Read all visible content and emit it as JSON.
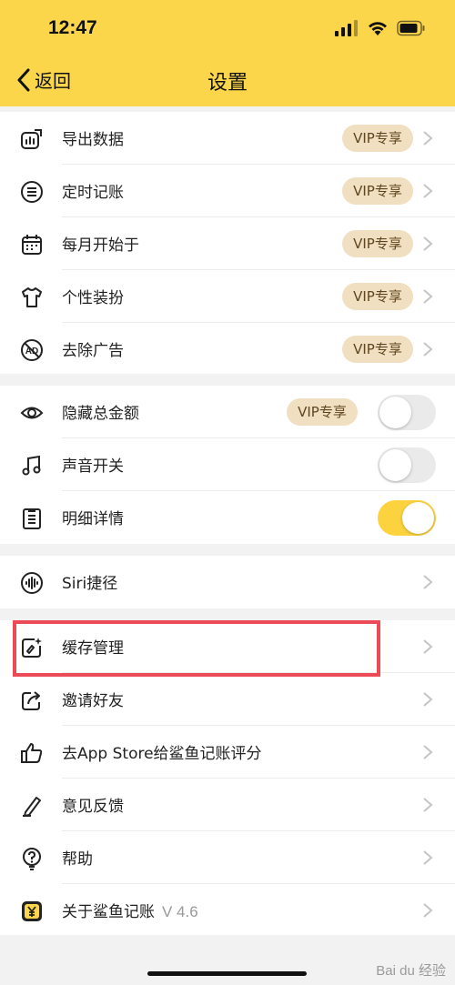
{
  "status": {
    "time": "12:47"
  },
  "nav": {
    "back_label": "返回",
    "title": "设置"
  },
  "group1": [
    {
      "label": "导出数据",
      "badge": "VIP专享"
    },
    {
      "label": "定时记账",
      "badge": "VIP专享"
    },
    {
      "label": "每月开始于",
      "badge": "VIP专享"
    },
    {
      "label": "个性装扮",
      "badge": "VIP专享"
    },
    {
      "label": "去除广告",
      "badge": "VIP专享"
    }
  ],
  "group2": [
    {
      "label": "隐藏总金额",
      "badge": "VIP专享",
      "toggle_on": false
    },
    {
      "label": "声音开关",
      "toggle_on": false
    },
    {
      "label": "明细详情",
      "toggle_on": true
    }
  ],
  "group3": [
    {
      "label": "Siri捷径"
    }
  ],
  "group4": [
    {
      "label": "缓存管理",
      "highlighted": true
    },
    {
      "label": "邀请好友"
    },
    {
      "label": "去App Store给鲨鱼记账评分"
    },
    {
      "label": "意见反馈"
    },
    {
      "label": "帮助"
    },
    {
      "label": "关于鲨鱼记账",
      "version": "V 4.6"
    }
  ],
  "watermark": "Bai du 经验",
  "colors": {
    "header": "#fcd64a",
    "vip_badge_bg": "#f1dfc1",
    "toggle_on": "#fcd33f",
    "highlight_border": "#ec4a57"
  }
}
